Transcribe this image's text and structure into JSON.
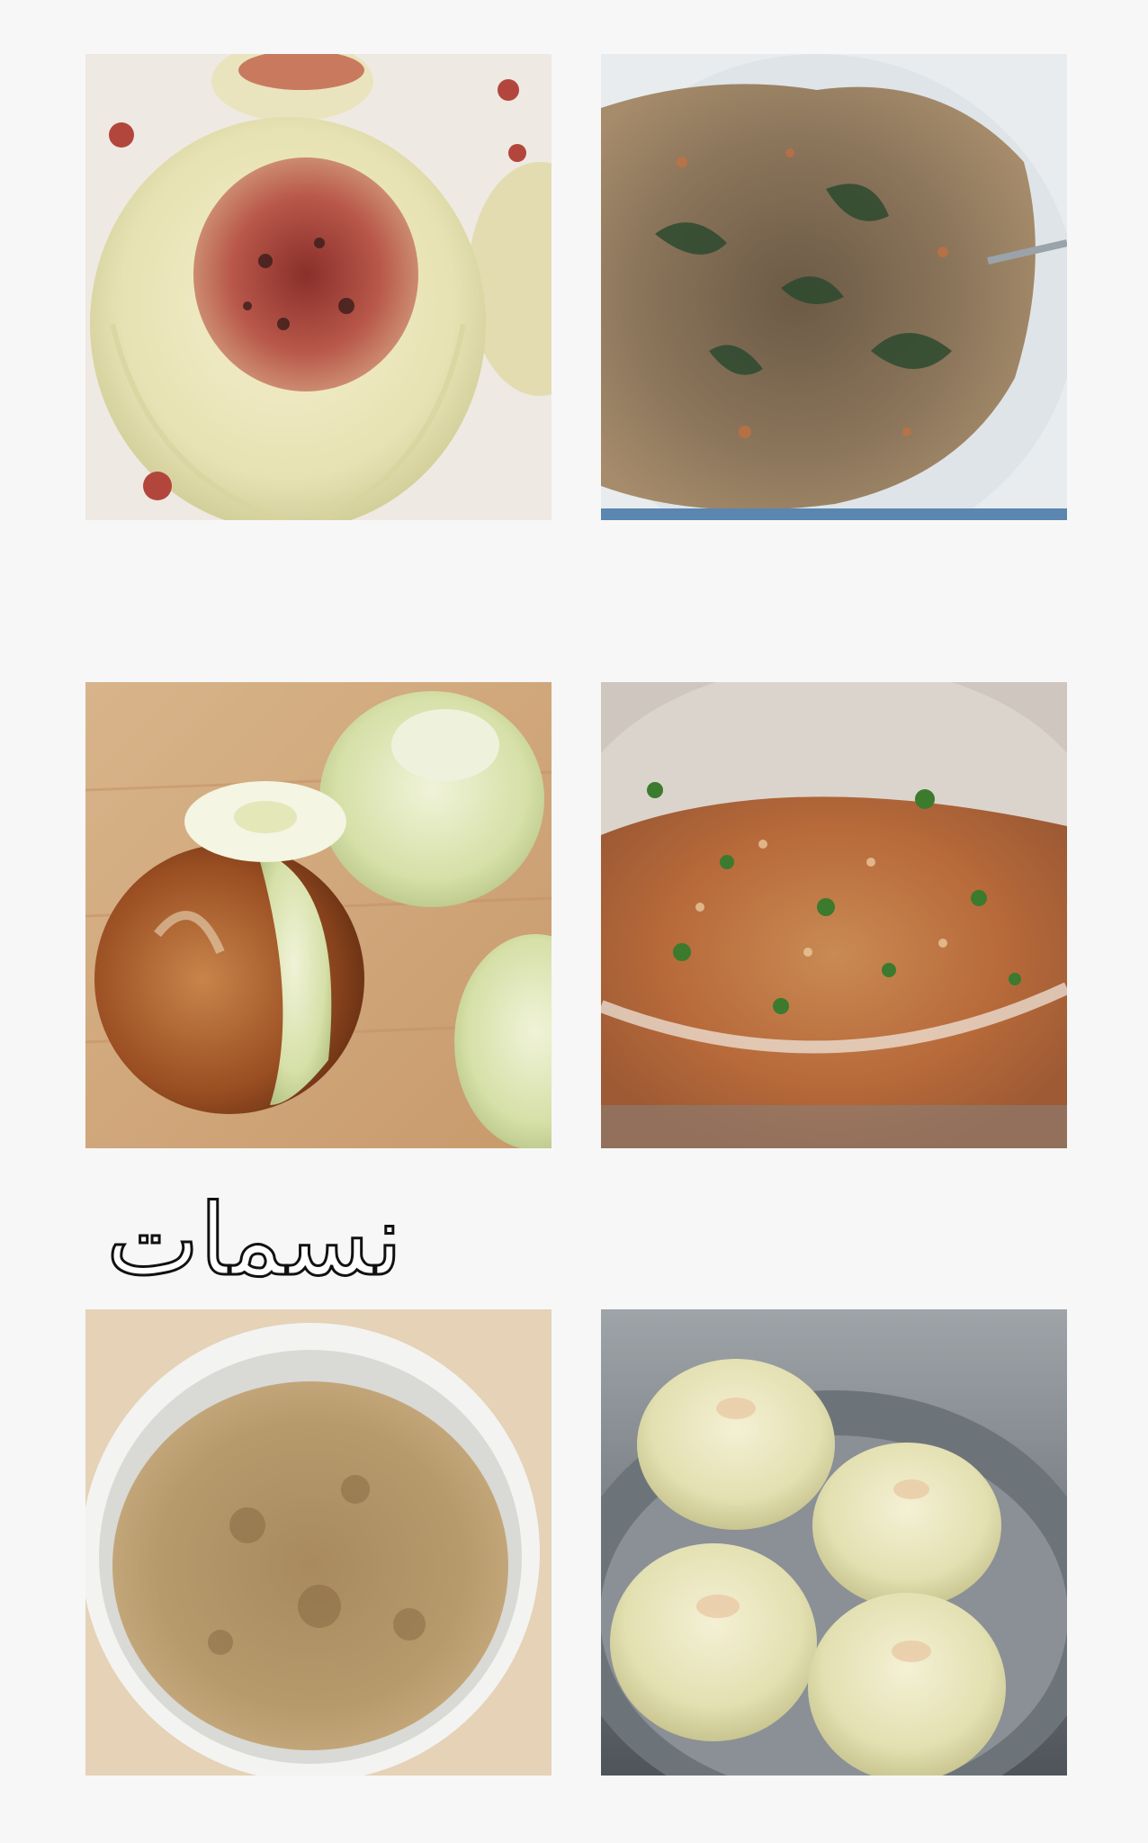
{
  "watermark": {
    "text": "نسمات"
  },
  "photos": [
    {
      "name": "stuffed-onion-photo"
    },
    {
      "name": "filling-mixture-photo"
    },
    {
      "name": "peeled-onions-photo"
    },
    {
      "name": "bulgur-salad-bowl-photo"
    },
    {
      "name": "bulgur-bowl-photo"
    },
    {
      "name": "boiled-onions-pot-photo"
    }
  ]
}
